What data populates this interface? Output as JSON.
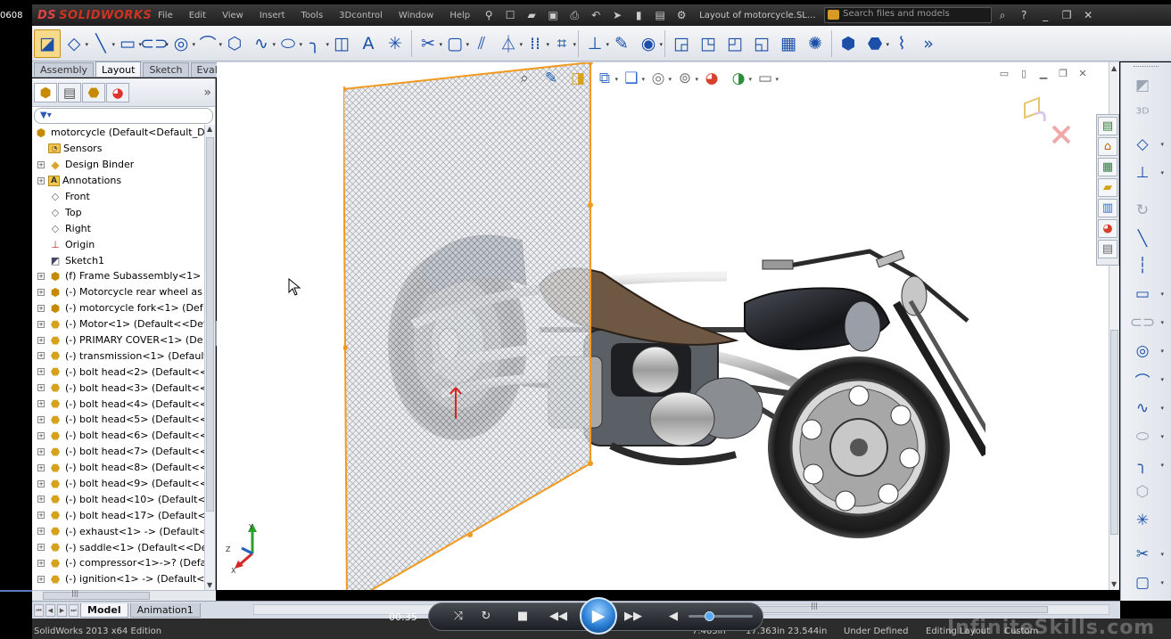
{
  "overlay": {
    "clock_text": "0608",
    "watermark": "InfiniteSkills.com"
  },
  "app": {
    "logo_text": "SOLIDWORKS",
    "window_title": "Layout of motorcycle.SL..."
  },
  "menu": {
    "items": [
      "File",
      "Edit",
      "View",
      "Insert",
      "Tools",
      "3Dcontrol",
      "Window",
      "Help"
    ]
  },
  "search": {
    "placeholder": "Search files and models"
  },
  "tabs": [
    {
      "label": "Assembly",
      "active": false
    },
    {
      "label": "Layout",
      "active": true
    },
    {
      "label": "Sketch",
      "active": false
    },
    {
      "label": "Evaluate",
      "active": false
    }
  ],
  "tree": {
    "root_label": "motorcycle  (Default<Default_D",
    "items": [
      {
        "label": "Sensors",
        "icon": "folder-icon",
        "expand": false
      },
      {
        "label": "Design Binder",
        "icon": "binder-icon",
        "expand": true
      },
      {
        "label": "Annotations",
        "icon": "annotations-icon",
        "expand": true
      },
      {
        "label": "Front",
        "icon": "plane-icon",
        "expand": false
      },
      {
        "label": "Top",
        "icon": "plane-icon",
        "expand": false
      },
      {
        "label": "Right",
        "icon": "plane-icon",
        "expand": false
      },
      {
        "label": "Origin",
        "icon": "origin-icon",
        "expand": false
      },
      {
        "label": "Sketch1",
        "icon": "sketch-icon",
        "expand": false
      },
      {
        "label": "(f) Frame Subassembly<1> (",
        "icon": "subassembly-icon",
        "expand": true
      },
      {
        "label": "(-) Motorcycle rear wheel as",
        "icon": "subassembly-icon",
        "expand": true
      },
      {
        "label": "(-) motorcycle fork<1> (Def",
        "icon": "subassembly-icon",
        "expand": true
      },
      {
        "label": "(-) Motor<1> (Default<<Def",
        "icon": "part-icon",
        "expand": true
      },
      {
        "label": "(-) PRIMARY COVER<1> (De",
        "icon": "part-icon",
        "expand": true
      },
      {
        "label": "(-) transmission<1> (Default",
        "icon": "part-icon",
        "expand": true
      },
      {
        "label": "(-) bolt head<2> (Default<<",
        "icon": "part-icon",
        "expand": true
      },
      {
        "label": "(-) bolt head<3> (Default<<",
        "icon": "part-icon",
        "expand": true
      },
      {
        "label": "(-) bolt head<4> (Default<<",
        "icon": "part-icon",
        "expand": true
      },
      {
        "label": "(-) bolt head<5> (Default<<",
        "icon": "part-icon",
        "expand": true
      },
      {
        "label": "(-) bolt head<6> (Default<<",
        "icon": "part-icon",
        "expand": true
      },
      {
        "label": "(-) bolt head<7> (Default<<",
        "icon": "part-icon",
        "expand": true
      },
      {
        "label": "(-) bolt head<8> (Default<<",
        "icon": "part-icon",
        "expand": true
      },
      {
        "label": "(-) bolt head<9> (Default<<",
        "icon": "part-icon",
        "expand": true
      },
      {
        "label": "(-) bolt head<10> (Default<",
        "icon": "part-icon",
        "expand": true
      },
      {
        "label": "(-) bolt head<17> (Default<",
        "icon": "part-icon",
        "expand": true
      },
      {
        "label": "(-) exhaust<1> -> (Default<",
        "icon": "part-icon",
        "expand": true
      },
      {
        "label": "(-) saddle<1> (Default<<De",
        "icon": "part-icon",
        "expand": true
      },
      {
        "label": "(-) compressor<1>->? (Defa",
        "icon": "part-icon",
        "expand": true
      },
      {
        "label": "(-) ignition<1> -> (Default<",
        "icon": "part-icon",
        "expand": true
      }
    ]
  },
  "bottom_tabs": [
    {
      "label": "Model",
      "active": true
    },
    {
      "label": "Animation1",
      "active": false
    }
  ],
  "status": {
    "edition": "SolidWorks 2013 x64 Edition",
    "coord_x": "7.465in",
    "coord_yz": "17.363in 23.544in",
    "definition": "Under Defined",
    "mode": "Editing Layout",
    "units": "Custom"
  },
  "player": {
    "time": "00:35"
  },
  "colors": {
    "accent_blue": "#1c4fa8",
    "selection_orange": "#f29a1f",
    "menubar_dark": "#2a2a2a"
  }
}
